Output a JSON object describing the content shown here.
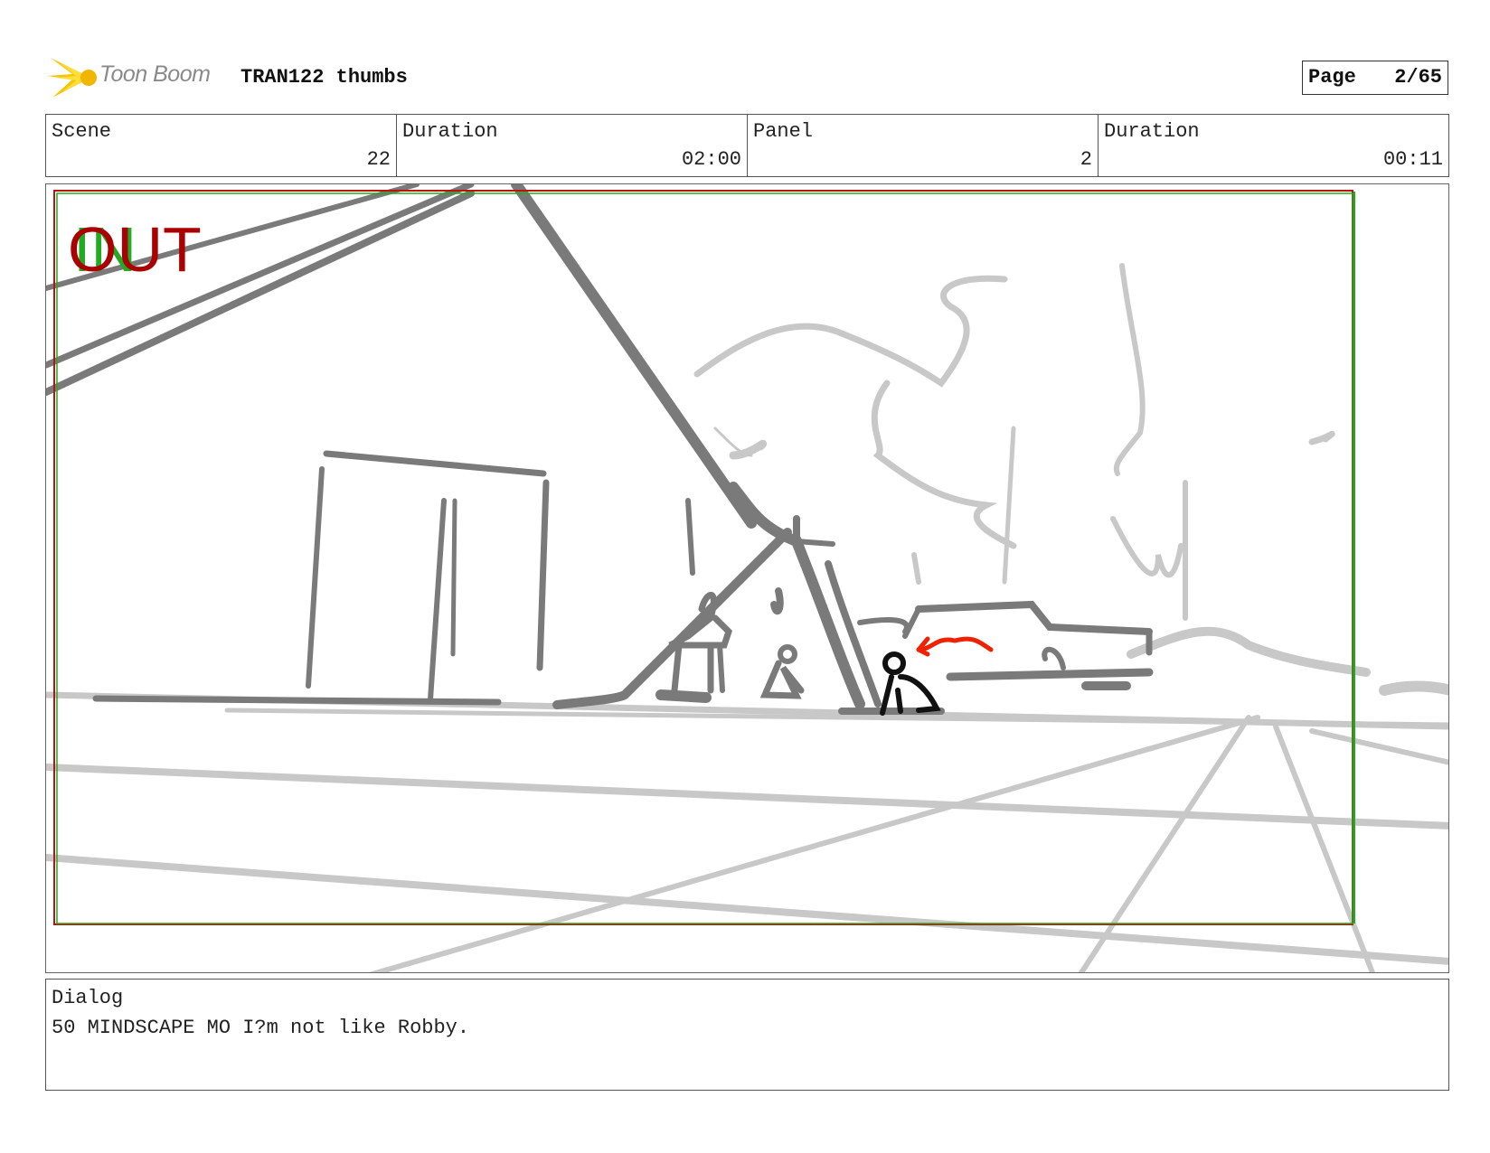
{
  "header": {
    "logo_text": "Toon Boom",
    "project_title": "TRAN122 thumbs",
    "page_label": "Page",
    "page_value": "2/65"
  },
  "info": {
    "scene_label": "Scene",
    "scene_value": "22",
    "scene_duration_label": "Duration",
    "scene_duration_value": "02:00",
    "panel_label": "Panel",
    "panel_value": "2",
    "panel_duration_label": "Duration",
    "panel_duration_value": "00:11"
  },
  "panel": {
    "in_marker": "IN",
    "out_marker": "OUT",
    "colors": {
      "in": "#22aa22",
      "out": "#aa0000",
      "frame_red": "#bb1111",
      "frame_green": "#22aa22",
      "ink_dark": "#777777",
      "ink_light": "#c8c8c8",
      "accent": "#ee2200"
    }
  },
  "dialog": {
    "label": "Dialog",
    "text": "50 MINDSCAPE MO I?m not like Robby."
  }
}
